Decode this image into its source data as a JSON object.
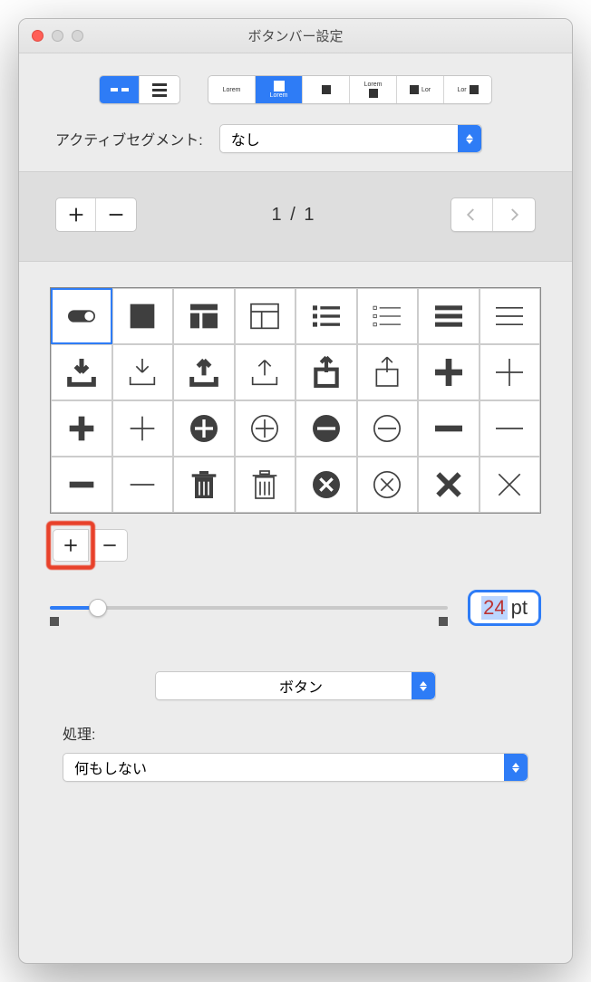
{
  "window": {
    "title": "ボタンバー設定"
  },
  "activeSegment": {
    "label": "アクティブセグメント:",
    "value": "なし"
  },
  "pager": {
    "text": "1 / 1"
  },
  "size": {
    "value": "24",
    "unit": "pt"
  },
  "typeSelect": {
    "value": "ボタン"
  },
  "action": {
    "label": "処理:",
    "value": "何もしない"
  },
  "icons": [
    "toggle",
    "square-fill",
    "layout-1",
    "layout-2",
    "list-fill",
    "list-thin",
    "menu-thick",
    "menu-thin",
    "download-fill",
    "download",
    "upload-fill",
    "upload",
    "share-fill",
    "share",
    "plus-bold",
    "plus-thin",
    "plus-bold2",
    "plus-thin2",
    "plus-circle-fill",
    "plus-circle",
    "minus-circle-fill",
    "minus-circle",
    "minus-bold",
    "minus-thin",
    "minus-bold2",
    "minus-thin2",
    "trash-fill",
    "trash",
    "x-circle-fill",
    "x-circle",
    "x-bold",
    "x-thin"
  ],
  "iconSelectedIndex": 0
}
